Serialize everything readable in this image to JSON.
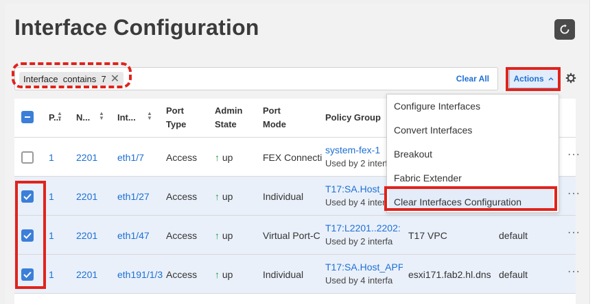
{
  "page": {
    "title": "Interface Configuration"
  },
  "filter": {
    "chip_text": "Interface  contains  7",
    "chip_close": "✕",
    "clear_all": "Clear All"
  },
  "toolbar": {
    "actions_label": "Actions",
    "actions_caret": "^"
  },
  "columns": {
    "p": "P...",
    "n": "N...",
    "int": "Int...",
    "port_type_1": "Port",
    "port_type_2": "Type",
    "admin_state_1": "Admin",
    "admin_state_2": "State",
    "port_mode_1": "Port",
    "port_mode_2": "Mode",
    "policy_group": "Policy Group"
  },
  "rows": [
    {
      "p": "1",
      "n": "2201",
      "int": "eth1/7",
      "type": "Access",
      "admin": "up",
      "mode": "FEX Connecti",
      "pg": "system-fex-1",
      "pg_sub": "Used by 2 interfa",
      "desc": "",
      "extra": "",
      "selected": false
    },
    {
      "p": "1",
      "n": "2201",
      "int": "eth1/27",
      "type": "Access",
      "admin": "up",
      "mode": "Individual",
      "pg": "T17:SA.Host_",
      "pg_sub": "Used by 4 interfa",
      "desc": "",
      "extra": "",
      "selected": true
    },
    {
      "p": "1",
      "n": "2201",
      "int": "eth1/47",
      "type": "Access",
      "admin": "up",
      "mode": "Virtual Port-C",
      "pg": "T17:L2201..2202:",
      "pg_sub": "Used by 2 interfa",
      "desc": "T17 VPC",
      "extra": "default",
      "selected": true
    },
    {
      "p": "1",
      "n": "2201",
      "int": "eth191/1/3",
      "type": "Access",
      "admin": "up",
      "mode": "Individual",
      "pg": "T17:SA.Host_APP",
      "pg_sub": "Used by 4 interfa",
      "desc": "esxi171.fab2.hl.dns",
      "extra": "default",
      "selected": true
    }
  ],
  "row_more": "···",
  "actions_menu": {
    "items": [
      "Configure Interfaces",
      "Convert Interfaces",
      "Breakout",
      "Fabric Extender",
      "Clear Interfaces Configuration"
    ]
  },
  "colors": {
    "accent": "#1d6fd4",
    "highlight_red": "#e0231b",
    "up_green": "#1e9e3e"
  }
}
